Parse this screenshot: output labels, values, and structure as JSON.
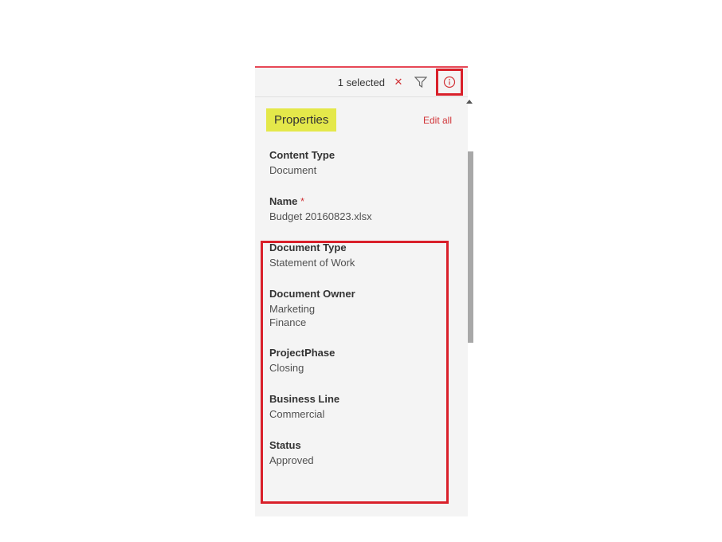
{
  "toolbar": {
    "selected_text": "1 selected",
    "close_symbol": "✕"
  },
  "panel": {
    "title": "Properties",
    "edit_all_label": "Edit all"
  },
  "fields": [
    {
      "label": "Content Type",
      "value": "Document",
      "required": false
    },
    {
      "label": "Name",
      "value": "Budget 20160823.xlsx",
      "required": true
    },
    {
      "label": "Document Type",
      "value": "Statement of Work",
      "required": false
    },
    {
      "label": "Document Owner",
      "value": "Marketing\nFinance",
      "required": false
    },
    {
      "label": "ProjectPhase",
      "value": "Closing",
      "required": false
    },
    {
      "label": "Business Line",
      "value": "Commercial",
      "required": false
    },
    {
      "label": "Status",
      "value": "Approved",
      "required": false
    }
  ],
  "colors": {
    "accent_red": "#d13438",
    "highlight_yellow": "#e4e84a",
    "annotation_red": "#d9202a"
  }
}
